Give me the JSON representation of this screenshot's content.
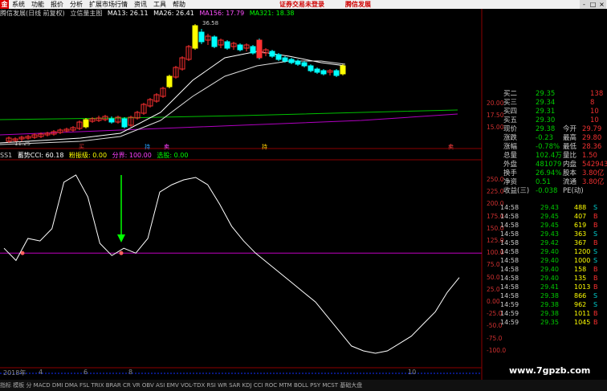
{
  "menu": {
    "logo": "金",
    "items": [
      "系统",
      "功能",
      "报价",
      "分析",
      "扩展市场行情",
      "资讯",
      "工具",
      "帮助"
    ],
    "login_notice": "证券交易未登录",
    "brand": "腾信发展",
    "controls": [
      "-",
      "□",
      "×"
    ]
  },
  "header": {
    "title": "腾信发展(日线 前复权)",
    "subtitle": "立信量主图",
    "ma13": "MA13: 26.11",
    "ma26": "MA26: 26.41",
    "ma156": "MA156: 17.79",
    "ma321": "MA321: 18.38",
    "high_label": "36.58",
    "low_label": "11.25"
  },
  "indicator_header": {
    "name": "SS1",
    "cci": "蓄势CCI: 60.18",
    "break": "粉振级: 0.00",
    "score": "分界: 100.00",
    "pick": "选股: 0.00"
  },
  "price_axis": [
    "20.00",
    "17.50",
    "15.00"
  ],
  "ind_axis": [
    "250.0",
    "225.0",
    "200.0",
    "175.0",
    "150.0",
    "125.0",
    "100.0",
    "75.0",
    "50.0",
    "25.0",
    "0.00",
    "-25.0",
    "-50.0",
    "-75.0",
    "-100.0"
  ],
  "x_labels": [
    "2018年",
    "4",
    "6",
    "8",
    "10"
  ],
  "markers": [
    "买",
    "持",
    "卖",
    "持",
    "卖"
  ],
  "quote": {
    "rows": [
      {
        "l": "买二",
        "v": "29.35",
        "r": "138"
      },
      {
        "l": "买三",
        "v": "29.34",
        "r": "8"
      },
      {
        "l": "买四",
        "v": "29.31",
        "r": "10"
      },
      {
        "l": "买五",
        "v": "29.30",
        "r": "10"
      },
      {
        "l": "现价",
        "v": "29.38",
        "m": "今开",
        "r": "29.79"
      },
      {
        "l": "涨跌",
        "v": "-0.23",
        "m": "最高",
        "r": "29.80"
      },
      {
        "l": "涨幅",
        "v": "-0.78%",
        "m": "最低",
        "r": "28.36"
      },
      {
        "l": "总量",
        "v": "102.4万",
        "m": "量比",
        "r": "1.50"
      },
      {
        "l": "外盘",
        "v": "481079",
        "m": "内盘",
        "r": "542943"
      },
      {
        "l": "换手",
        "v": "26.94%",
        "m": "股本",
        "r": "3.80亿"
      },
      {
        "l": "净资",
        "v": "0.51",
        "m": "流通",
        "r": "3.80亿"
      },
      {
        "l": "收益(三)",
        "v": "-0.038",
        "m": "PE(动)",
        "r": ""
      }
    ]
  },
  "trades": [
    {
      "t": "14:58",
      "p": "29.43",
      "v": "488",
      "s": "S"
    },
    {
      "t": "14:58",
      "p": "29.45",
      "v": "407",
      "s": "B"
    },
    {
      "t": "14:58",
      "p": "29.45",
      "v": "619",
      "s": "B"
    },
    {
      "t": "14:58",
      "p": "29.43",
      "v": "363",
      "s": "S"
    },
    {
      "t": "14:58",
      "p": "29.42",
      "v": "367",
      "s": "B"
    },
    {
      "t": "14:58",
      "p": "29.40",
      "v": "1200",
      "s": "S"
    },
    {
      "t": "14:58",
      "p": "29.40",
      "v": "1000",
      "s": "S"
    },
    {
      "t": "14:58",
      "p": "29.40",
      "v": "158",
      "s": "B"
    },
    {
      "t": "14:58",
      "p": "29.40",
      "v": "135",
      "s": "B"
    },
    {
      "t": "14:58",
      "p": "29.41",
      "v": "1013",
      "s": "B"
    },
    {
      "t": "14:58",
      "p": "29.38",
      "v": "866",
      "s": "S"
    },
    {
      "t": "14:59",
      "p": "29.38",
      "v": "962",
      "s": "S"
    },
    {
      "t": "14:59",
      "p": "29.38",
      "v": "1011",
      "s": "B"
    },
    {
      "t": "14:59",
      "p": "29.35",
      "v": "1045",
      "s": "B"
    }
  ],
  "footer": "指标 模板 分 MACD DMI DMA FSL TRIX BRAR CR VR OBV ASI EMV VOL-TDX RSI WR SAR KDJ CCI ROC MTM BOLL PSY MCST 基础大盘",
  "watermark": "www.7gpzb.com",
  "colors": {
    "up": "#ff3030",
    "down": "#00ffff",
    "yellow": "#ffff00",
    "white": "#ffffff",
    "magenta": "#c000c0",
    "green": "#00cc00"
  },
  "chart_data": [
    {
      "type": "candlestick",
      "title": "腾信发展(日线 前复权)",
      "ylim": [
        11.25,
        36.58
      ],
      "series": [
        {
          "name": "MA13"
        },
        {
          "name": "MA26"
        },
        {
          "name": "MA156"
        },
        {
          "name": "MA321"
        }
      ]
    },
    {
      "type": "line",
      "title": "SS1",
      "ylim": [
        -100,
        250
      ],
      "threshold": 100,
      "series": [
        {
          "name": "蓄势CCI",
          "values": [
            110,
            85,
            130,
            125,
            150,
            245,
            260,
            215,
            120,
            95,
            110,
            100,
            130,
            225,
            240,
            250,
            255,
            240,
            200,
            155,
            125,
            100,
            80,
            60,
            40,
            20,
            0,
            -30,
            -60,
            -90,
            -100,
            -105,
            -100,
            -85,
            -70,
            -45,
            -20,
            20,
            50
          ]
        }
      ]
    }
  ]
}
